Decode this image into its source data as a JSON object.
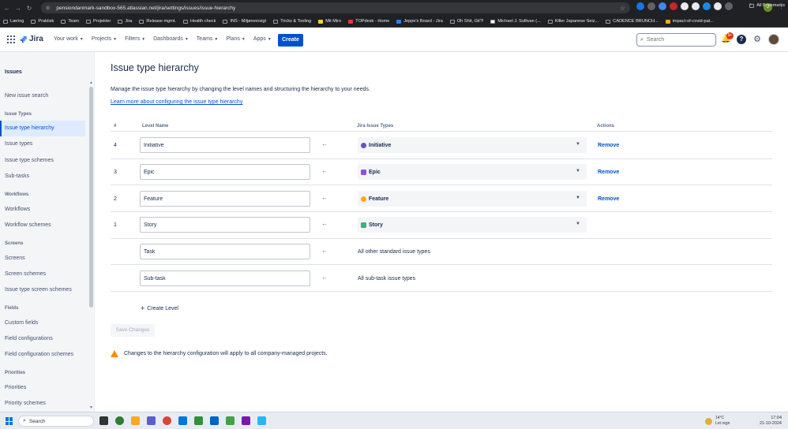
{
  "browser": {
    "url": "pensiondanmark-sandbox-565.atlassian.net/jira/settings/issues/issue-hierarchy",
    "profile_initial": "J",
    "bookmarks": [
      "Læring",
      "Praktisk",
      "Team",
      "Projekter",
      "Jira",
      "Release mgmt.",
      "Health check",
      "INS - Miljøoversigt",
      "Tricks & Tooling",
      "Mit Miro",
      "TOPdesk - Home",
      "Jeppe's Board - Jira",
      "Oh Shit, Git?!",
      "Michael J. Sullivan (...",
      "Killer Japanese Seiz...",
      "CADENCE BRUNCH...",
      "impact-of-covid-pat..."
    ],
    "all_bookmarks": "All Bookmarks"
  },
  "topnav": {
    "logo": "Jira",
    "items": [
      "Your work",
      "Projects",
      "Filters",
      "Dashboards",
      "Teams",
      "Plans",
      "Apps"
    ],
    "create": "Create",
    "search_placeholder": "Search",
    "notif_count": "9+"
  },
  "sidebar": {
    "title": "Issues",
    "new_issue_search": "New issue search",
    "sections": {
      "issue_types": "Issue Types",
      "workflows": "Workflows",
      "screens": "Screens",
      "fields": "Fields",
      "priorities": "Priorities"
    },
    "links": {
      "issue_type_hierarchy": "Issue type hierarchy",
      "issue_types": "Issue types",
      "issue_type_schemes": "Issue type schemes",
      "sub_tasks": "Sub-tasks",
      "workflows": "Workflows",
      "workflow_schemes": "Workflow schemes",
      "screens": "Screens",
      "screen_schemes": "Screen schemes",
      "issue_type_screen_schemes": "Issue type screen schemes",
      "custom_fields": "Custom fields",
      "field_configurations": "Field configurations",
      "field_configuration_schemes": "Field configuration schemes",
      "priorities": "Priorities",
      "priority_schemes": "Priority schemes"
    }
  },
  "main": {
    "title": "Issue type hierarchy",
    "description": "Manage the issue type hierarchy by changing the level names and structuring the hierarchy to your needs.",
    "learn_more": "Learn more about configuring the issue type hierarchy",
    "columns": {
      "num": "#",
      "level_name": "Level Name",
      "issue_types": "Jira Issue Types",
      "actions": "Actions"
    },
    "rows": [
      {
        "num": "4",
        "level_name": "Initiative",
        "issue_type": "Initiative",
        "icon_color": "#6554C0",
        "action": "Remove"
      },
      {
        "num": "3",
        "level_name": "Epic",
        "issue_type": "Epic",
        "icon_color": "#904EE2",
        "action": "Remove"
      },
      {
        "num": "2",
        "level_name": "Feature",
        "issue_type": "Feature",
        "icon_color": "#FFAB00",
        "action": "Remove"
      },
      {
        "num": "1",
        "level_name": "Story",
        "issue_type": "Story",
        "icon_color": "#36B37E",
        "action": ""
      },
      {
        "num": "",
        "level_name": "Task",
        "issue_type_text": "All other standard issue types"
      },
      {
        "num": "",
        "level_name": "Sub-task",
        "issue_type_text": "All sub-task issue types"
      }
    ],
    "create_level": "Create Level",
    "save_changes": "Save Changes",
    "warning": "Changes to the hierarchy configuration will apply to all company-managed projects."
  },
  "taskbar": {
    "search": "Search",
    "temp": "14°C",
    "weather": "Let regn",
    "time": "17:04",
    "date": "21-10-2024"
  }
}
